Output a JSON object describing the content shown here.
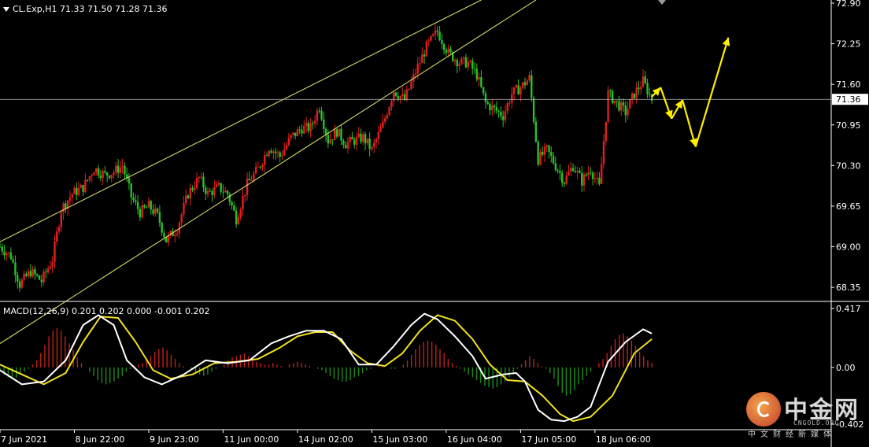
{
  "chart_data": [
    {
      "type": "candlestick",
      "symbol_header": "CL.Exp,H1  71.33 71.50 71.28 71.36",
      "ylim": [
        68.2,
        72.9
      ],
      "y_ticks": [
        "72.90",
        "72.25",
        "71.60",
        "70.95",
        "70.30",
        "69.65",
        "69.00",
        "68.35"
      ],
      "y_tick_values": [
        72.9,
        72.25,
        71.6,
        70.95,
        70.3,
        69.65,
        69.0,
        68.35
      ],
      "current_price": "71.36",
      "current_price_value": 71.36,
      "x_ticks": [
        "7 Jun 2021",
        "8 Jun 22:00",
        "9 Jun 23:00",
        "11 Jun 00:00",
        "14 Jun 02:00",
        "15 Jun 03:00",
        "16 Jun 04:00",
        "17 Jun 05:00",
        "18 Jun 06:00"
      ],
      "colors": {
        "up": "#e0201e",
        "down": "#29c12a",
        "channel": "#e8e870",
        "forecast": "#ffee00",
        "grid_axis": "#ffffff"
      },
      "price_path": [
        [
          0,
          69.0
        ],
        [
          5,
          68.85
        ],
        [
          9,
          68.4
        ],
        [
          14,
          68.6
        ],
        [
          19,
          68.45
        ],
        [
          24,
          68.8
        ],
        [
          28,
          69.6
        ],
        [
          33,
          69.85
        ],
        [
          38,
          69.95
        ],
        [
          43,
          70.25
        ],
        [
          48,
          70.15
        ],
        [
          52,
          70.2
        ],
        [
          56,
          70.3
        ],
        [
          60,
          69.8
        ],
        [
          64,
          69.55
        ],
        [
          68,
          69.65
        ],
        [
          72,
          69.5
        ],
        [
          76,
          69.1
        ],
        [
          81,
          69.3
        ],
        [
          86,
          69.85
        ],
        [
          91,
          70.1
        ],
        [
          95,
          69.85
        ],
        [
          100,
          69.95
        ],
        [
          104,
          69.85
        ],
        [
          108,
          69.45
        ],
        [
          113,
          70.0
        ],
        [
          118,
          70.25
        ],
        [
          123,
          70.6
        ],
        [
          128,
          70.45
        ],
        [
          133,
          70.75
        ],
        [
          138,
          70.9
        ],
        [
          142,
          70.9
        ],
        [
          146,
          71.25
        ],
        [
          150,
          70.7
        ],
        [
          154,
          70.85
        ],
        [
          158,
          70.65
        ],
        [
          162,
          70.7
        ],
        [
          166,
          70.75
        ],
        [
          170,
          70.55
        ],
        [
          175,
          70.95
        ],
        [
          180,
          71.5
        ],
        [
          185,
          71.35
        ],
        [
          190,
          71.8
        ],
        [
          195,
          72.2
        ],
        [
          200,
          72.45
        ],
        [
          205,
          72.1
        ],
        [
          210,
          71.95
        ],
        [
          214,
          71.95
        ],
        [
          218,
          71.75
        ],
        [
          222,
          71.3
        ],
        [
          226,
          71.2
        ],
        [
          230,
          71.1
        ],
        [
          234,
          71.45
        ],
        [
          238,
          71.55
        ],
        [
          242,
          71.7
        ],
        [
          246,
          70.4
        ],
        [
          250,
          70.55
        ],
        [
          254,
          70.3
        ],
        [
          258,
          70.05
        ],
        [
          262,
          70.3
        ],
        [
          266,
          70.05
        ],
        [
          270,
          70.25
        ],
        [
          274,
          69.95
        ],
        [
          278,
          71.45
        ],
        [
          282,
          71.3
        ],
        [
          286,
          71.15
        ],
        [
          290,
          71.45
        ],
        [
          294,
          71.65
        ],
        [
          298,
          71.36
        ]
      ],
      "channel": [
        {
          "start": [
            0,
            69.08
          ],
          "end": [
            220,
            72.95
          ]
        },
        {
          "start": [
            0,
            67.45
          ],
          "end": [
            245,
            72.95
          ]
        }
      ],
      "horizontal_line": 71.36,
      "forecast_path": [
        [
          298,
          71.4
        ],
        [
          302,
          71.55
        ],
        [
          307,
          71.05
        ],
        [
          312,
          71.35
        ],
        [
          318,
          70.6
        ],
        [
          333,
          72.35
        ]
      ],
      "x_ticks_index": [
        0,
        34,
        68,
        102,
        136,
        170,
        204,
        238,
        272
      ],
      "x_range": [
        0,
        380
      ]
    },
    {
      "type": "macd",
      "header": "MACD(12,26,9) 0.201 0.202 0.000 -0.001 0.202",
      "ylim": [
        -0.402,
        0.417
      ],
      "y_ticks": [
        "0.417",
        "0.00",
        "-0.402"
      ],
      "y_tick_values": [
        0.417,
        0.0,
        -0.402
      ],
      "histogram": [
        -0.02,
        -0.05,
        -0.07,
        -0.08,
        -0.07,
        -0.05,
        -0.03,
        -0.01,
        0.02,
        0.05,
        0.1,
        0.16,
        0.22,
        0.26,
        0.28,
        0.26,
        0.22,
        0.17,
        0.12,
        0.07,
        0.03,
        0.0,
        -0.03,
        -0.06,
        -0.09,
        -0.11,
        -0.12,
        -0.11,
        -0.1,
        -0.08,
        -0.06,
        -0.03,
        -0.01,
        0.01,
        0.02,
        0.03,
        0.05,
        0.08,
        0.11,
        0.13,
        0.14,
        0.12,
        0.09,
        0.06,
        0.03,
        0.01,
        0.0,
        -0.01,
        -0.03,
        -0.05,
        -0.06,
        -0.05,
        -0.03,
        -0.01,
        0.0,
        0.02,
        0.05,
        0.07,
        0.08,
        0.09,
        0.1,
        0.08,
        0.06,
        0.04,
        0.03,
        0.02,
        0.02,
        0.03,
        0.02,
        0.01,
        0.0,
        0.02,
        0.03,
        0.04,
        0.03,
        0.02,
        0.01,
        0.0,
        -0.01,
        -0.02,
        -0.04,
        -0.06,
        -0.08,
        -0.09,
        -0.1,
        -0.1,
        -0.09,
        -0.07,
        -0.06,
        -0.04,
        -0.02,
        -0.01,
        0.0,
        0.01,
        0.01,
        0.0,
        -0.01,
        -0.01,
        0.0,
        0.02,
        0.05,
        0.09,
        0.13,
        0.16,
        0.18,
        0.19,
        0.18,
        0.16,
        0.13,
        0.1,
        0.06,
        0.03,
        0.01,
        -0.01,
        -0.03,
        -0.05,
        -0.07,
        -0.09,
        -0.11,
        -0.13,
        -0.14,
        -0.15,
        -0.14,
        -0.12,
        -0.1,
        -0.07,
        -0.04,
        -0.01,
        0.02,
        0.05,
        0.08,
        0.06,
        0.03,
        0.01,
        -0.01,
        -0.04,
        -0.08,
        -0.13,
        -0.18,
        -0.2,
        -0.19,
        -0.16,
        -0.12,
        -0.09,
        -0.06,
        -0.03,
        0.0,
        0.03,
        0.06,
        0.1,
        0.15,
        0.2,
        0.23,
        0.24,
        0.22,
        0.19,
        0.15,
        0.11,
        0.08,
        0.05,
        0.03
      ],
      "macd_line": [
        [
          0,
          -0.02
        ],
        [
          10,
          -0.12
        ],
        [
          20,
          -0.1
        ],
        [
          30,
          0.05
        ],
        [
          38,
          0.3
        ],
        [
          45,
          0.37
        ],
        [
          52,
          0.3
        ],
        [
          58,
          0.05
        ],
        [
          66,
          -0.07
        ],
        [
          74,
          -0.12
        ],
        [
          84,
          -0.05
        ],
        [
          94,
          0.05
        ],
        [
          104,
          0.03
        ],
        [
          114,
          0.05
        ],
        [
          124,
          0.17
        ],
        [
          132,
          0.22
        ],
        [
          140,
          0.26
        ],
        [
          148,
          0.26
        ],
        [
          156,
          0.2
        ],
        [
          164,
          0.02
        ],
        [
          172,
          0.02
        ],
        [
          180,
          0.15
        ],
        [
          188,
          0.3
        ],
        [
          194,
          0.38
        ],
        [
          200,
          0.34
        ],
        [
          208,
          0.22
        ],
        [
          216,
          0.08
        ],
        [
          222,
          -0.08
        ],
        [
          230,
          -0.05
        ],
        [
          236,
          -0.04
        ],
        [
          240,
          -0.1
        ],
        [
          246,
          -0.3
        ],
        [
          252,
          -0.37
        ],
        [
          258,
          -0.38
        ],
        [
          264,
          -0.35
        ],
        [
          270,
          -0.28
        ],
        [
          278,
          0.04
        ],
        [
          286,
          0.18
        ],
        [
          294,
          0.27
        ],
        [
          298,
          0.24
        ]
      ],
      "signal_line": [
        [
          0,
          0.02
        ],
        [
          10,
          -0.05
        ],
        [
          20,
          -0.12
        ],
        [
          30,
          -0.04
        ],
        [
          38,
          0.18
        ],
        [
          46,
          0.36
        ],
        [
          54,
          0.35
        ],
        [
          62,
          0.18
        ],
        [
          70,
          -0.02
        ],
        [
          78,
          -0.08
        ],
        [
          88,
          -0.05
        ],
        [
          98,
          0.03
        ],
        [
          108,
          0.04
        ],
        [
          118,
          0.06
        ],
        [
          128,
          0.14
        ],
        [
          136,
          0.22
        ],
        [
          144,
          0.25
        ],
        [
          152,
          0.25
        ],
        [
          160,
          0.12
        ],
        [
          168,
          0.03
        ],
        [
          176,
          0.01
        ],
        [
          184,
          0.1
        ],
        [
          192,
          0.26
        ],
        [
          200,
          0.37
        ],
        [
          208,
          0.33
        ],
        [
          216,
          0.2
        ],
        [
          224,
          0.02
        ],
        [
          232,
          -0.09
        ],
        [
          240,
          -0.1
        ],
        [
          248,
          -0.2
        ],
        [
          256,
          -0.33
        ],
        [
          262,
          -0.38
        ],
        [
          270,
          -0.35
        ],
        [
          280,
          -0.2
        ],
        [
          290,
          0.1
        ],
        [
          298,
          0.2
        ]
      ],
      "colors": {
        "hist_pos": "#c0201e",
        "hist_neg": "#1d8c1d",
        "macd": "#ffffff",
        "signal": "#f0e020"
      },
      "x_range": [
        0,
        380
      ]
    }
  ],
  "watermark": {
    "brand": "中金网",
    "domain": "CNGOLD.ORG",
    "sub": "中文财经新媒体"
  }
}
